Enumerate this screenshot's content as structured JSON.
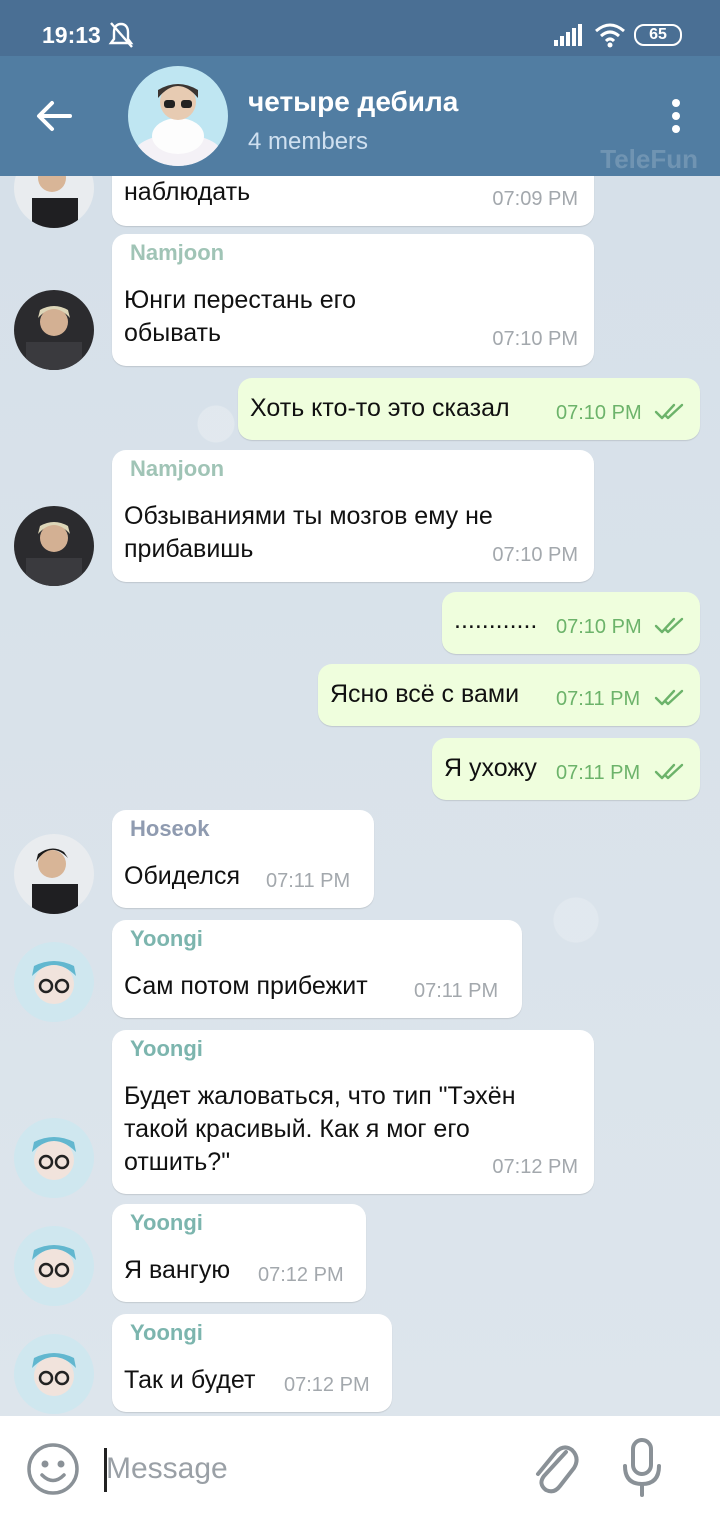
{
  "status_bar": {
    "time": "19:13",
    "battery": "65"
  },
  "header": {
    "title": "четыре дебила",
    "subtitle": "4 members",
    "watermark": "TeleFun"
  },
  "messages": [
    {
      "text": "наблюдать",
      "time": "07:09 PM"
    },
    {
      "sender": "Namjoon",
      "text": "Юнги перестань его\nобывать",
      "time": "07:10 PM"
    },
    {
      "text": "Хоть кто-то это сказал",
      "time": "07:10 PM"
    },
    {
      "sender": "Namjoon",
      "text": "Обзываниями ты мозгов ему не\nприбавишь",
      "time": "07:10 PM"
    },
    {
      "text": "............",
      "time": "07:10 PM"
    },
    {
      "text": "Ясно всё с вами",
      "time": "07:11 PM"
    },
    {
      "text": "Я ухожу",
      "time": "07:11 PM"
    },
    {
      "sender": "Hoseok",
      "text": "Обиделся",
      "time": "07:11 PM"
    },
    {
      "sender": "Yoongi",
      "text": "Сам потом прибежит",
      "time": "07:11 PM"
    },
    {
      "sender": "Yoongi",
      "text": "Будет жаловаться, что тип \"Тэхён\nтакой красивый. Как я мог его\nотшить?\"",
      "time": "07:12 PM"
    },
    {
      "sender": "Yoongi",
      "text": "Я вангую",
      "time": "07:12 PM"
    },
    {
      "sender": "Yoongi",
      "text": "Так и будет",
      "time": "07:12 PM"
    }
  ],
  "input": {
    "placeholder": "Message"
  },
  "colors": {
    "header": "#517da2",
    "status_bar": "#4a6f94",
    "outgoing_bubble": "#effedd",
    "namjoon": "#a0c4b6",
    "hoseok": "#8f9bb0",
    "yoongi": "#7cb5ae",
    "read_check": "#6cb36a"
  }
}
